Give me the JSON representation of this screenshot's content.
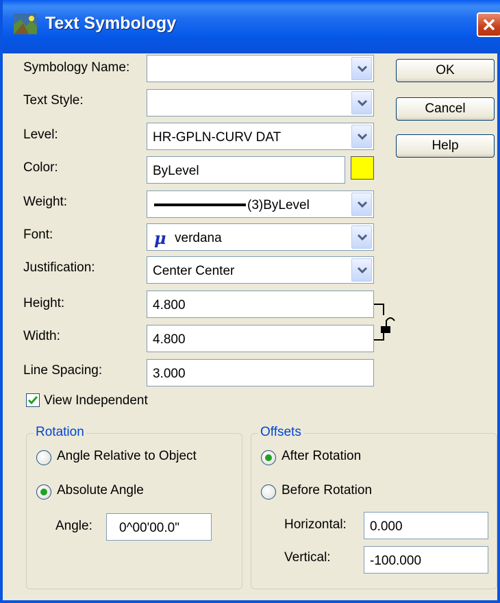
{
  "window": {
    "title": "Text Symbology",
    "close_symbol": "✕"
  },
  "fields": {
    "symbology_name": {
      "label": "Symbology Name:",
      "value": ""
    },
    "text_style": {
      "label": "Text Style:",
      "value": ""
    },
    "level": {
      "label": "Level:",
      "value": "HR-GPLN-CURV DAT"
    },
    "color": {
      "label": "Color:",
      "value": "ByLevel",
      "swatch": "#ffff00"
    },
    "weight": {
      "label": "Weight:",
      "value": "(3)ByLevel"
    },
    "font": {
      "label": "Font:",
      "value": "verdana",
      "icon_glyph": "μ"
    },
    "justification": {
      "label": "Justification:",
      "value": "Center Center"
    },
    "height": {
      "label": "Height:",
      "value": "4.800"
    },
    "width": {
      "label": "Width:",
      "value": "4.800"
    },
    "line_spacing": {
      "label": "Line Spacing:",
      "value": "3.000"
    }
  },
  "buttons": {
    "ok": "OK",
    "cancel": "Cancel",
    "help": "Help"
  },
  "view_independent": {
    "label": "View Independent",
    "checked": true
  },
  "rotation": {
    "title": "Rotation",
    "options": [
      {
        "label": "Angle Relative to Object",
        "selected": false
      },
      {
        "label": "Absolute Angle",
        "selected": true
      }
    ],
    "angle_label": "Angle:",
    "angle_value": "0^00'00.0\""
  },
  "offsets": {
    "title": "Offsets",
    "options": [
      {
        "label": "After Rotation",
        "selected": true
      },
      {
        "label": "Before Rotation",
        "selected": false
      }
    ],
    "horizontal_label": "Horizontal:",
    "horizontal_value": "0.000",
    "vertical_label": "Vertical:",
    "vertical_value": "-100.000"
  },
  "colors": {
    "title_bar": "#0a5cf1",
    "group_title": "#0046d5",
    "radio_dot": "#21a121"
  }
}
